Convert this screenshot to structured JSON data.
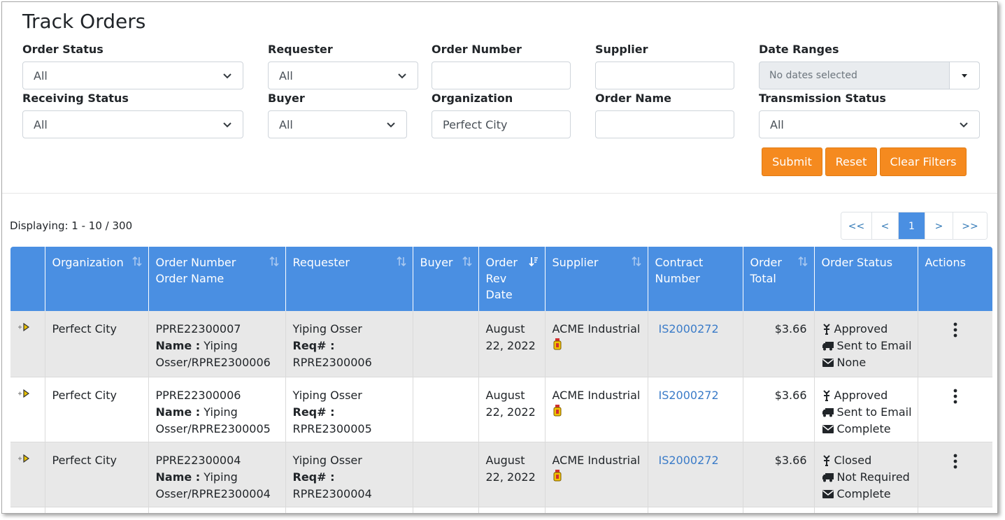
{
  "page": {
    "title": "Track Orders"
  },
  "filters": {
    "order_status": {
      "label": "Order Status",
      "value": "All"
    },
    "requester": {
      "label": "Requester",
      "value": "All"
    },
    "order_number": {
      "label": "Order Number",
      "value": ""
    },
    "supplier": {
      "label": "Supplier",
      "value": ""
    },
    "date_ranges": {
      "label": "Date Ranges",
      "placeholder": "No dates selected"
    },
    "receiving_status": {
      "label": "Receiving Status",
      "value": "All"
    },
    "buyer": {
      "label": "Buyer",
      "value": "All"
    },
    "organization": {
      "label": "Organization",
      "value": "Perfect City"
    },
    "order_name": {
      "label": "Order Name",
      "value": ""
    },
    "transmission_status": {
      "label": "Transmission Status",
      "value": "All"
    }
  },
  "buttons": {
    "submit": "Submit",
    "reset": "Reset",
    "clear": "Clear Filters"
  },
  "listing": {
    "displaying": "Displaying: 1 - 10 / 300"
  },
  "pagination": {
    "first": "<<",
    "prev": "<",
    "current": "1",
    "next": ">",
    "last": ">>"
  },
  "table": {
    "headers": {
      "organization": "Organization",
      "order_number": "Order Number",
      "order_name": "Order Name",
      "requester": "Requester",
      "buyer": "Buyer",
      "rev_date_1": "Order",
      "rev_date_2": "Rev",
      "rev_date_3": "Date",
      "supplier": "Supplier",
      "contract_1": "Contract",
      "contract_2": "Number",
      "total_1": "Order",
      "total_2": "Total",
      "status": "Order Status",
      "actions": "Actions"
    },
    "name_label": "Name :",
    "req_label": "Req# :",
    "rows": [
      {
        "organization": "Perfect City",
        "order_number": "PPRE22300007",
        "order_name_1": "Yiping",
        "order_name_2": "Osser/RPRE2300006",
        "requester": "Yiping Osser",
        "req_no": "RPRE2300006",
        "buyer": "",
        "date_1": "August",
        "date_2": "22, 2022",
        "supplier": "ACME Industrial",
        "contract": "IS2000272",
        "total": "$3.66",
        "approval": "Approved",
        "transmission": "Sent to Email",
        "receipt": "None"
      },
      {
        "organization": "Perfect City",
        "order_number": "PPRE22300006",
        "order_name_1": "Yiping",
        "order_name_2": "Osser/RPRE2300005",
        "requester": "Yiping Osser",
        "req_no": "RPRE2300005",
        "buyer": "",
        "date_1": "August",
        "date_2": "22, 2022",
        "supplier": "ACME Industrial",
        "contract": "IS2000272",
        "total": "$3.66",
        "approval": "Approved",
        "transmission": "Sent to Email",
        "receipt": "Complete"
      },
      {
        "organization": "Perfect City",
        "order_number": "PPRE22300004",
        "order_name_1": "Yiping",
        "order_name_2": "Osser/RPRE2300004",
        "requester": "Yiping Osser",
        "req_no": "RPRE2300004",
        "buyer": "",
        "date_1": "August",
        "date_2": "22, 2022",
        "supplier": "ACME Industrial",
        "contract": "IS2000272",
        "total": "$3.66",
        "approval": "Closed",
        "transmission": "Not Required",
        "receipt": "Complete"
      }
    ]
  },
  "colors": {
    "accent_orange": "#f58a1f",
    "header_blue": "#4a8fe2",
    "link_blue": "#3a7bc8",
    "row_grey": "#e8e8e8"
  },
  "icons": [
    "chevron-down-icon",
    "caret-down-icon",
    "sort-icon",
    "sort-desc-icon",
    "expand-row-icon",
    "contract-item-icon",
    "approval-icon",
    "truck-icon",
    "envelope-icon",
    "kebab-menu-icon"
  ]
}
